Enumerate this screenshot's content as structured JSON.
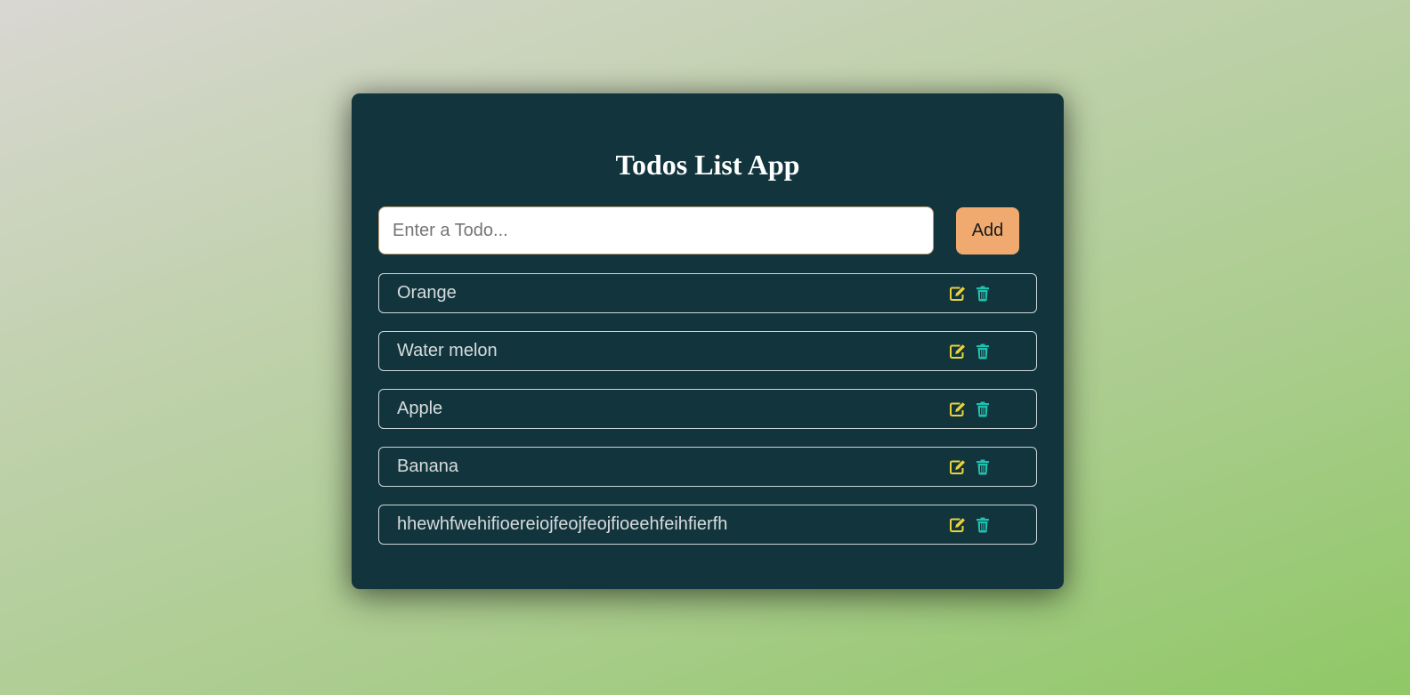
{
  "app": {
    "title": "Todos List App"
  },
  "input": {
    "placeholder": "Enter a Todo...",
    "value": ""
  },
  "add_button": {
    "label": "Add"
  },
  "todos": [
    {
      "text": "Orange"
    },
    {
      "text": "Water melon"
    },
    {
      "text": "Apple"
    },
    {
      "text": "Banana"
    },
    {
      "text": "hhewhfwehifioereiojfeojfeojfioeehfeihfierfh"
    }
  ],
  "icons": {
    "edit": "edit-icon",
    "delete": "trash-icon"
  },
  "colors": {
    "card_bg": "#12353d",
    "add_button_bg": "#f0aa70",
    "edit_icon": "#e9d23a",
    "delete_icon": "#1ec3b0"
  }
}
